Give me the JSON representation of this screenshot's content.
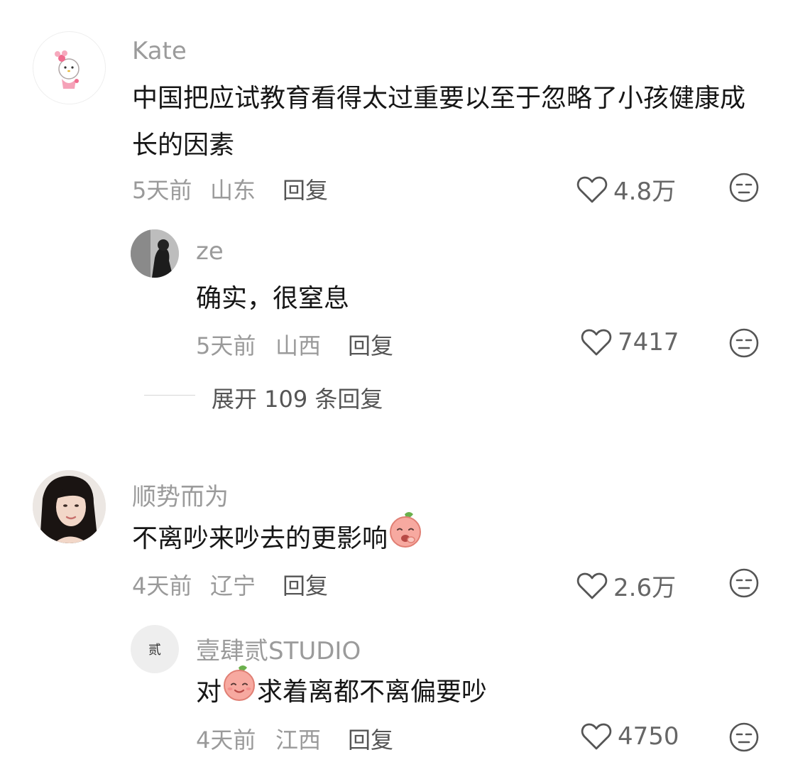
{
  "comments": [
    {
      "username": "Kate",
      "text": "中国把应试教育看得太过重要以至于忽略了小孩健康成长的因素",
      "time": "5天前",
      "location": "山东",
      "reply_label": "回复",
      "likes": "4.8万",
      "replies": [
        {
          "username": "ze",
          "text": "确实，很窒息",
          "time": "5天前",
          "location": "山西",
          "reply_label": "回复",
          "likes": "7417"
        }
      ],
      "expand_label": "展开 109 条回复"
    },
    {
      "username": "顺势而为",
      "text": "不离吵来吵去的更影响",
      "time": "4天前",
      "location": "辽宁",
      "reply_label": "回复",
      "likes": "2.6万",
      "replies": [
        {
          "username": "壹肆贰STUDIO",
          "avatar_text": "贰",
          "text_before": "对",
          "text_after": "求着离都不离偏要吵",
          "time": "4天前",
          "location": "江西",
          "reply_label": "回复",
          "likes": "4750"
        }
      ]
    }
  ],
  "icons": {
    "like": "heart-outline-icon",
    "dislike": "meh-face-icon"
  },
  "colors": {
    "username": "#9b9b9b",
    "body": "#161616",
    "meta": "#9a9a9a"
  }
}
